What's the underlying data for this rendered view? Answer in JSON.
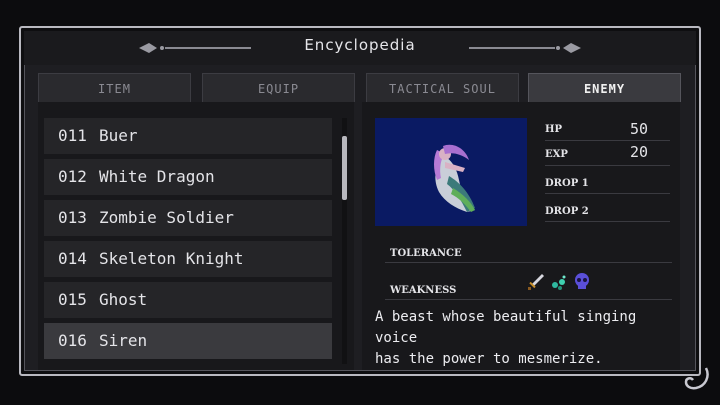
{
  "header": {
    "title": "Encyclopedia"
  },
  "tabs": [
    {
      "label": "ITEM",
      "active": false
    },
    {
      "label": "EQUIP",
      "active": false
    },
    {
      "label": "TACTICAL SOUL",
      "active": false
    },
    {
      "label": "ENEMY",
      "active": true
    }
  ],
  "list": {
    "items": [
      {
        "num": "011",
        "name": "Buer"
      },
      {
        "num": "012",
        "name": "White Dragon"
      },
      {
        "num": "013",
        "name": "Zombie Soldier"
      },
      {
        "num": "014",
        "name": "Skeleton Knight"
      },
      {
        "num": "015",
        "name": "Ghost"
      },
      {
        "num": "016",
        "name": "Siren"
      }
    ],
    "selected_index": 5
  },
  "enemy": {
    "portrait_icon": "siren-sprite",
    "hp_label": "HP",
    "hp": "50",
    "exp_label": "EXP",
    "exp": "20",
    "drop1_label": "DROP 1",
    "drop2_label": "DROP 2",
    "tolerance_label": "TOLERANCE",
    "weakness_label": "WEAKNESS",
    "weakness_icons": [
      "sword-icon",
      "green-orb-icon",
      "blue-skull-icon"
    ],
    "description": "A beast whose beautiful singing voice\nhas the power to mesmerize."
  },
  "colors": {
    "portrait_bg": "#0a1a63",
    "frame": "#b9b9c0",
    "selected_row": "#3a3a3e"
  }
}
